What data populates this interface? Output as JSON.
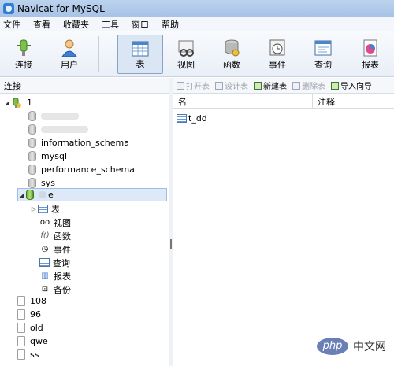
{
  "window": {
    "title": "Navicat for MySQL"
  },
  "menu": [
    "文件",
    "查看",
    "收藏夹",
    "工具",
    "窗口",
    "帮助"
  ],
  "toolbar": {
    "buttons": [
      {
        "label": "连接",
        "icon": "connection-icon"
      },
      {
        "label": "用户",
        "icon": "user-icon"
      },
      {
        "label": "表",
        "icon": "table-icon",
        "active": true
      },
      {
        "label": "视图",
        "icon": "view-icon"
      },
      {
        "label": "函数",
        "icon": "function-icon"
      },
      {
        "label": "事件",
        "icon": "event-icon"
      },
      {
        "label": "查询",
        "icon": "query-icon"
      },
      {
        "label": "报表",
        "icon": "report-icon"
      }
    ]
  },
  "left_panel": {
    "header": "连接",
    "connection_name": "1",
    "databases": [
      "information_schema",
      "mysql",
      "performance_schema",
      "sys"
    ],
    "selected_db_partial": "e",
    "sub_items": [
      "表",
      "视图",
      "函数",
      "事件",
      "查询",
      "报表",
      "备份"
    ],
    "other_connections": [
      "108",
      "96",
      "old",
      "qwe",
      "ss"
    ]
  },
  "object_toolbar": {
    "buttons": [
      {
        "label": "打开表",
        "enabled": false
      },
      {
        "label": "设计表",
        "enabled": false
      },
      {
        "label": "新建表",
        "enabled": true
      },
      {
        "label": "删除表",
        "enabled": false
      },
      {
        "label": "导入向导",
        "enabled": true
      }
    ]
  },
  "object_list": {
    "columns": [
      "名",
      "注释"
    ],
    "rows": [
      {
        "name": "t_dd"
      }
    ]
  },
  "watermark": {
    "logo": "php",
    "text": "中文网"
  },
  "colors": {
    "titlebar": "#bcd3ee",
    "selection": "#dde9f8",
    "accent": "#2f7fd4"
  }
}
